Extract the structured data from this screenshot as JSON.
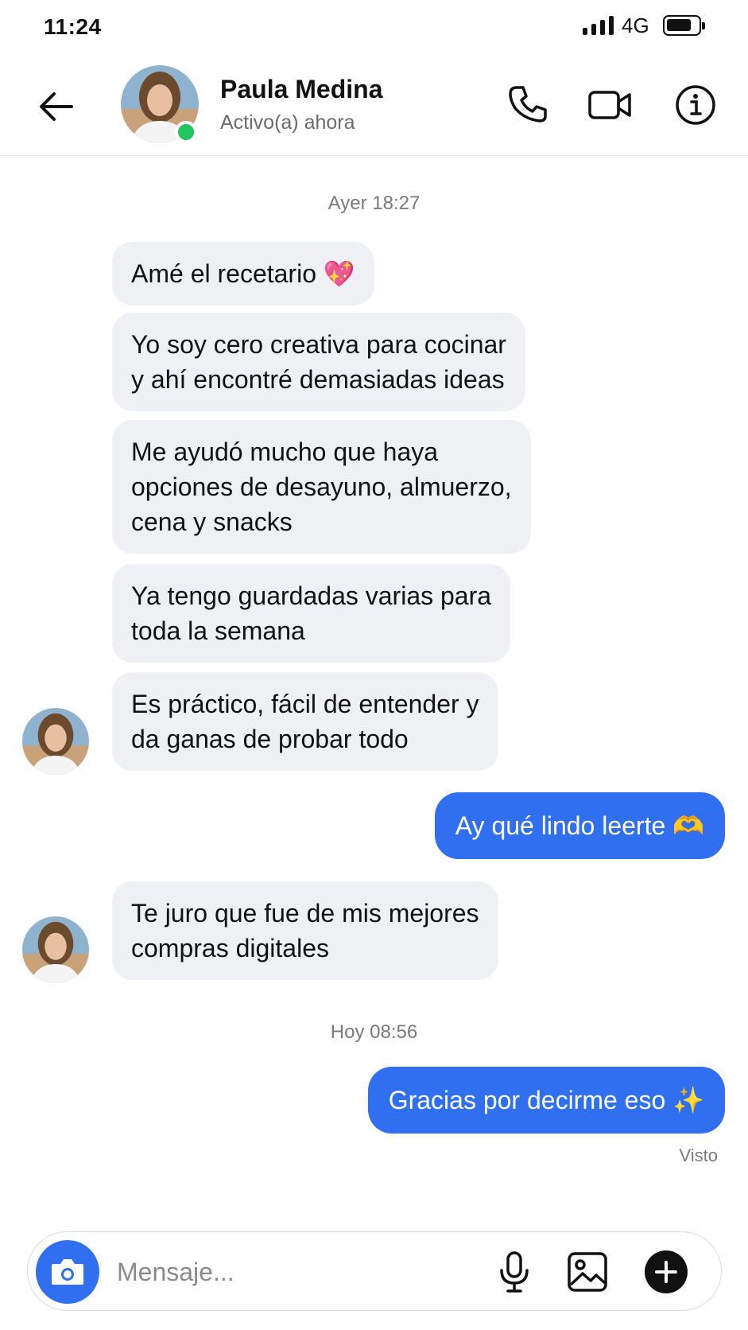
{
  "status_bar": {
    "time": "11:24",
    "network": "4G"
  },
  "header": {
    "contact_name": "Paula Medina",
    "contact_status": "Activo(a) ahora"
  },
  "thread": {
    "ts1": "Ayer 18:27",
    "m1": "Amé el recetario 💖",
    "m2": "Yo soy cero creativa para cocinar\ny ahí encontré demasiadas ideas",
    "m3": "Me ayudó mucho que haya\nopciones de desayuno, almuerzo,\ncena y snacks",
    "m4": "Ya tengo guardadas varias para\ntoda la semana",
    "m5": "Es práctico, fácil de entender y\nda ganas de probar todo",
    "m6": "Ay qué lindo leerte 🫶",
    "m7": "Te juro que fue de mis mejores\ncompras digitales",
    "ts2": "Hoy 08:56",
    "m8": "Gracias por decirme eso ✨",
    "seen": "Visto"
  },
  "composer": {
    "placeholder": "Mensaje..."
  },
  "colors": {
    "accent": "#2f6ff0",
    "incoming_bubble": "#eff0f4",
    "online": "#22c55e"
  }
}
